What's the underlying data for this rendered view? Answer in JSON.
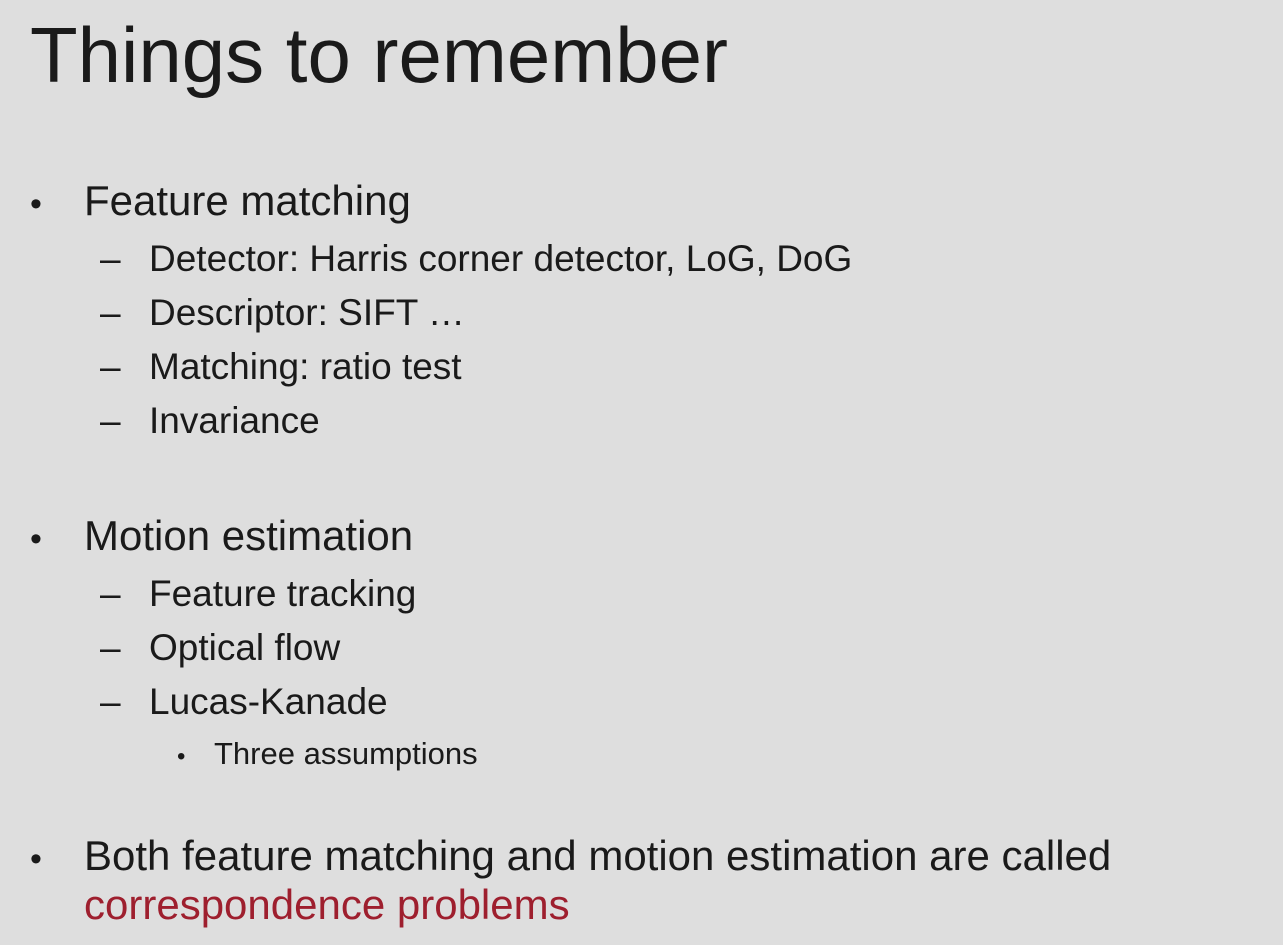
{
  "title": "Things to remember",
  "bullets": [
    {
      "label": "Feature matching",
      "children": [
        "Detector: Harris corner detector, LoG, DoG",
        "Descriptor: SIFT …",
        "Matching: ratio test",
        "Invariance"
      ]
    },
    {
      "label": "Motion estimation",
      "children": [
        "Feature tracking",
        "Optical flow",
        "Lucas-Kanade"
      ],
      "sub_children": [
        "Three assumptions"
      ]
    },
    {
      "label": "Both feature matching and motion estimation are called",
      "continuation": "correspondence problems"
    }
  ],
  "colors": {
    "background": "#dedede",
    "text": "#1a1a1a",
    "accent": "#9e1f2e"
  }
}
